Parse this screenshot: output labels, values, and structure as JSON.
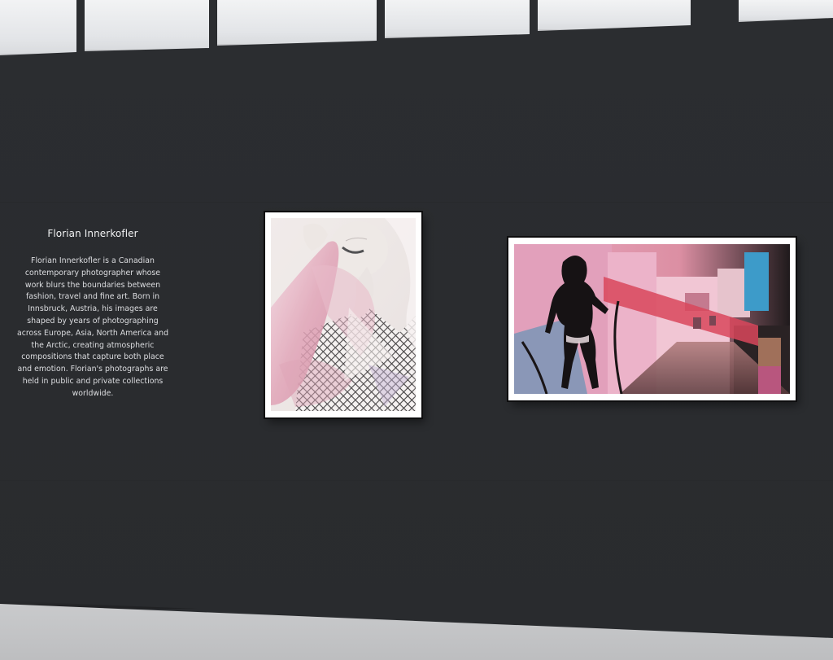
{
  "artist": {
    "name": "Florian Innerkofler",
    "bio_lines": [
      "Florian Innerkofler is a Canadian",
      "contemporary photographer whose",
      "work blurs the boundaries between",
      "fashion, travel and fine art. Born in",
      "Innsbruck, Austria, his images are",
      "shaped by years of photographing",
      "across Europe, Asia, North America and",
      "the Arctic, creating atmospheric",
      "compositions that capture both place",
      "and emotion. Florian's photographs are",
      "held in public and private collections",
      "worldwide."
    ]
  },
  "artworks": [
    {
      "subject": "portrait-pink-hair-fishnet",
      "palette": [
        "#ece7e4",
        "#e8b9c8",
        "#d58fa6",
        "#2c2a2c",
        "#f6f3f2"
      ]
    },
    {
      "subject": "silhouette-figure-pink-buildings",
      "palette": [
        "#e9a3bd",
        "#1a1516",
        "#d9495e",
        "#3f9fcc",
        "#8c3f4a",
        "#b87a5c"
      ]
    }
  ],
  "environment": {
    "wall_color": "#2a2c2f",
    "floor_color": "#c5c6c8",
    "skylight_color": "#eceef0"
  }
}
